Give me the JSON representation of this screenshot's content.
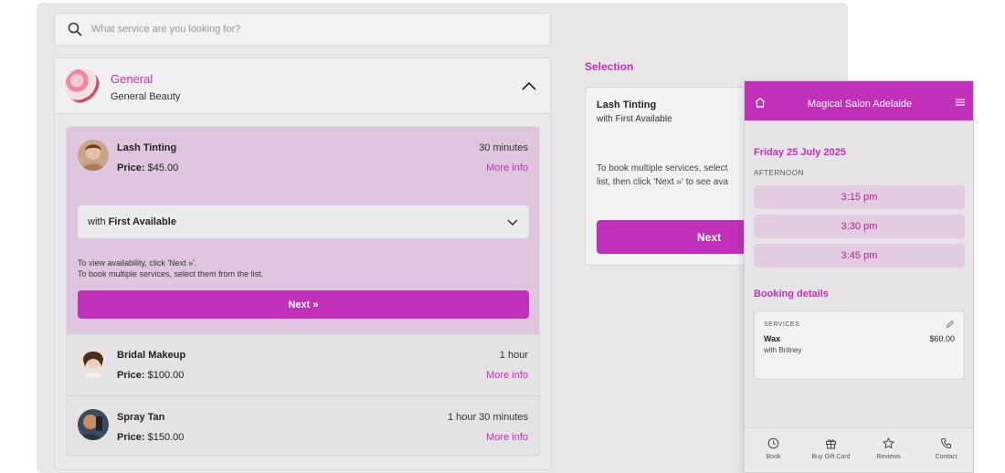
{
  "search": {
    "placeholder": "What service are you looking for?"
  },
  "category": {
    "title": "General",
    "subtitle": "General Beauty"
  },
  "services": [
    {
      "name": "Lash Tinting",
      "price_label": "Price:",
      "price": "$45.00",
      "duration": "30 minutes",
      "more": "More info"
    },
    {
      "name": "Bridal Makeup",
      "price_label": "Price:",
      "price": "$100.00",
      "duration": "1 hour",
      "more": "More info"
    },
    {
      "name": "Spray Tan",
      "price_label": "Price:",
      "price": "$150.00",
      "duration": "1 hour 30 minutes",
      "more": "More info"
    }
  ],
  "active_service": {
    "staff_prefix": "with",
    "staff_name": "First Available",
    "hint_line1": "To view availability, click 'Next »'.",
    "hint_line2": "To book multiple services, select them from the list.",
    "next_label": "Next »"
  },
  "selection": {
    "title": "Selection",
    "service": "Lash Tinting",
    "staff": "with First Available",
    "hint_line1": "To book multiple services, select",
    "hint_line2": "list, then click 'Next »' to see ava",
    "next_label": "Next"
  },
  "mobile": {
    "title": "Magical Salon Adelaide",
    "date": "Friday 25 July 2025",
    "period": "AFTERNOON",
    "slots": [
      "3:15 pm",
      "3:30 pm",
      "3:45 pm"
    ],
    "booking_title": "Booking details",
    "card": {
      "label": "SERVICES",
      "service": "Wax",
      "price": "$60.00",
      "staff": "with Britney"
    },
    "tabs": [
      {
        "label": "Book",
        "icon": "clock-icon"
      },
      {
        "label": "Buy Gift Card",
        "icon": "gift-icon"
      },
      {
        "label": "Reviews",
        "icon": "star-icon"
      },
      {
        "label": "Contact",
        "icon": "phone-icon"
      }
    ]
  },
  "colors": {
    "accent": "#c030b8",
    "selected_bg": "#dfc6de",
    "panel_bg": "#e9e7ea"
  }
}
